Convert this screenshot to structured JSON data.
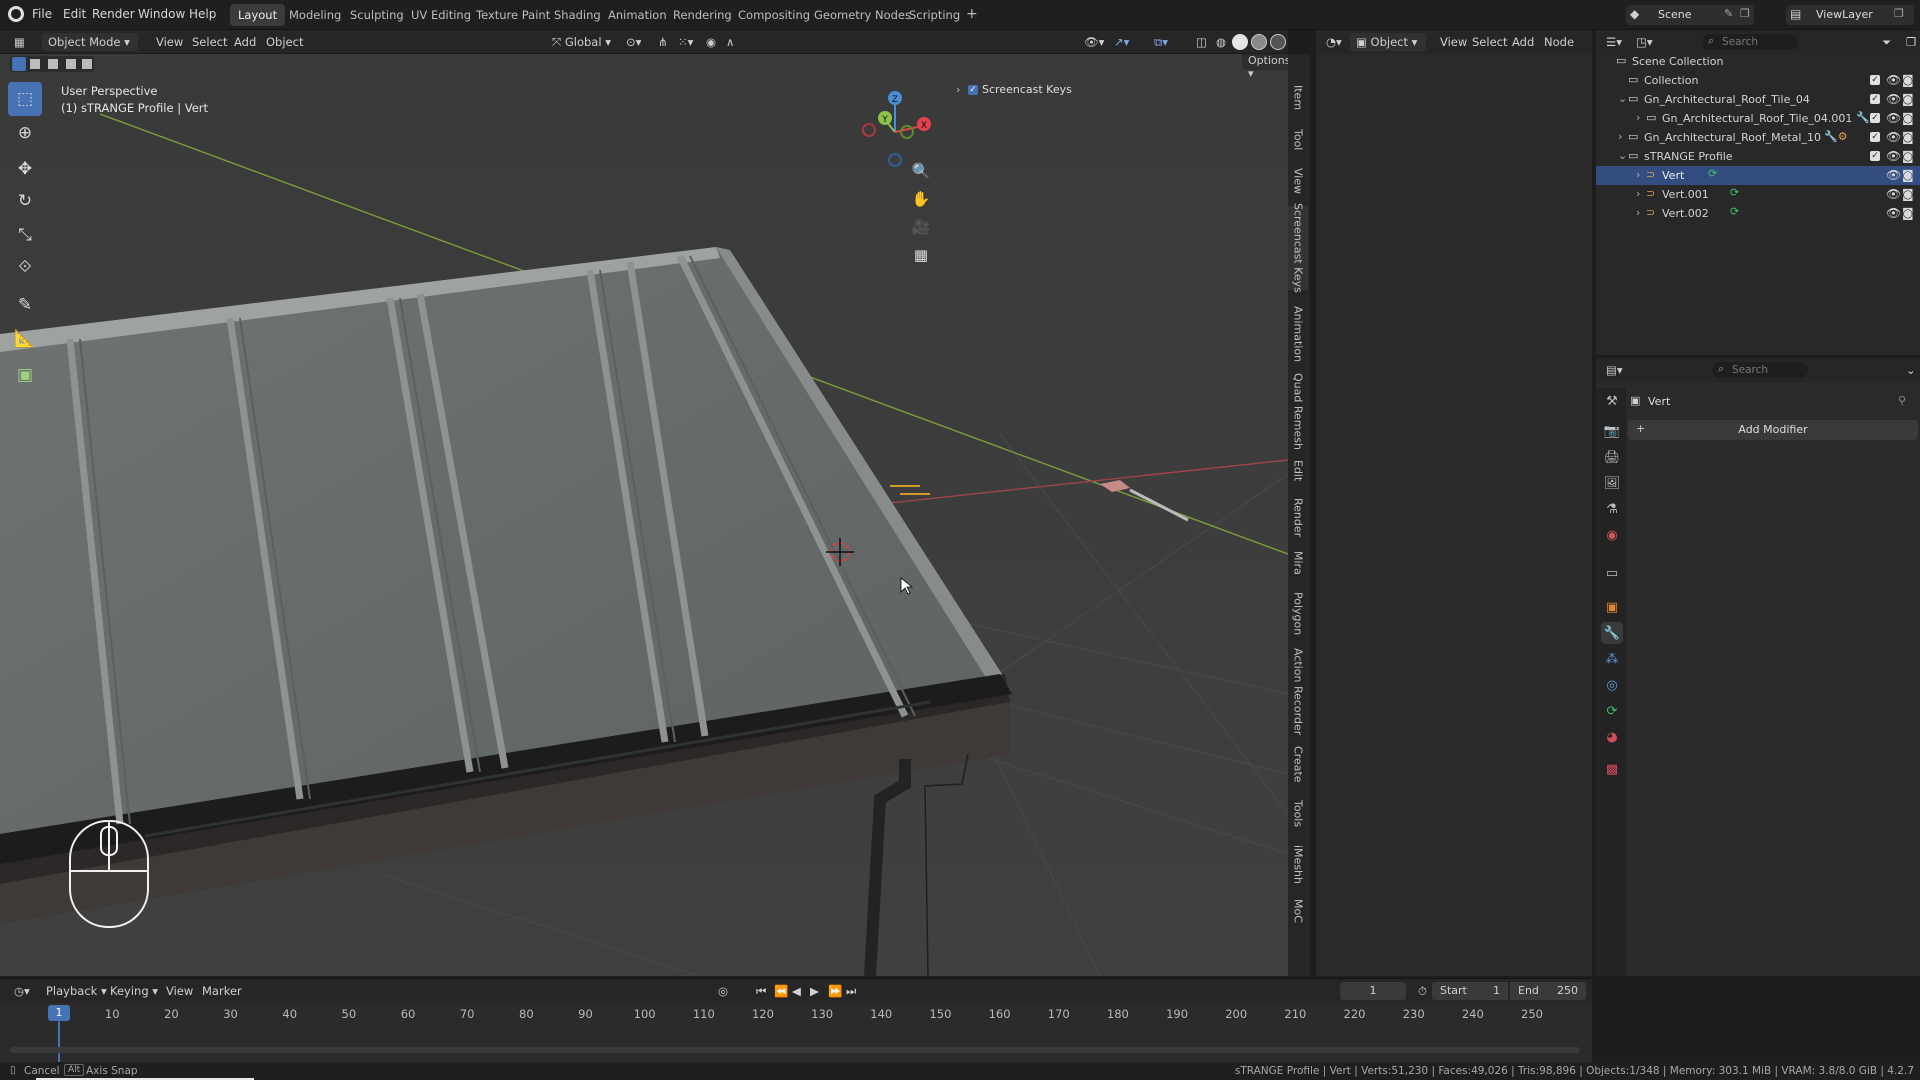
{
  "topbar": {
    "menus": [
      "File",
      "Edit",
      "Render",
      "Window",
      "Help"
    ],
    "workspaces": [
      "Layout",
      "Modeling",
      "Sculpting",
      "UV Editing",
      "Texture Paint",
      "Shading",
      "Animation",
      "Rendering",
      "Compositing",
      "Geometry Nodes",
      "Scripting"
    ],
    "active_workspace": "Layout",
    "add_tab": "+",
    "scene": "Scene",
    "view_layer": "ViewLayer"
  },
  "viewport_header": {
    "mode": "Object Mode",
    "menus": [
      "View",
      "Select",
      "Add",
      "Object"
    ],
    "transform_orientation": "Global",
    "options": "Options"
  },
  "viewport": {
    "perspective": "User Perspective",
    "context": "(1) sTRANGE Profile | Vert",
    "screencast_keys": "Screencast Keys",
    "gizmo_axes": [
      "Z",
      "Y",
      "X"
    ]
  },
  "n_tabs": [
    "Item",
    "Tool",
    "View",
    "Screencast Keys",
    "Animation",
    "Quad Remesh",
    "Edit",
    "Render",
    "Mira",
    "Polygon",
    "Action Recorder",
    "Create",
    "Tools",
    "iMeshh",
    "MoC"
  ],
  "node_header": {
    "object_menu": "Object",
    "menus": [
      "View",
      "Select",
      "Add",
      "Node"
    ]
  },
  "outliner": {
    "search_placeholder": "Search",
    "items": [
      {
        "label": "Scene Collection"
      },
      {
        "label": "Collection"
      },
      {
        "label": "Gn_Architectural_Roof_Tile_04"
      },
      {
        "label": "Gn_Architectural_Roof_Tile_04.001"
      },
      {
        "label": "Gn_Architectural_Roof_Metal_10"
      },
      {
        "label": "sTRANGE Profile"
      },
      {
        "label": "Vert"
      },
      {
        "label": "Vert.001"
      },
      {
        "label": "Vert.002"
      }
    ]
  },
  "properties": {
    "search_placeholder": "Search",
    "object_name": "Vert",
    "add_modifier": "Add Modifier"
  },
  "timeline": {
    "menus": [
      "Playback",
      "Keying",
      "View",
      "Marker"
    ],
    "current_frame": "1",
    "start_label": "Start",
    "start": "1",
    "end_label": "End",
    "end": "250",
    "ruler": [
      "1",
      "10",
      "20",
      "30",
      "40",
      "50",
      "60",
      "70",
      "80",
      "90",
      "100",
      "110",
      "120",
      "130",
      "140",
      "150",
      "160",
      "170",
      "180",
      "190",
      "200",
      "210",
      "220",
      "230",
      "240",
      "250"
    ]
  },
  "statusbar": {
    "cancel": "Cancel",
    "alt_key": "Alt",
    "axis_snap": "Axis Snap",
    "stats": "sTRANGE Profile | Vert | Verts:51,230 | Faces:49,026 | Tris:98,896 | Objects:1/348 | Memory: 303.1 MiB | VRAM: 3.8/8.0 GiB | 4.2.7"
  },
  "colors": {
    "accent": "#4772b3",
    "selected_row": "#334d80",
    "x_axis": "#e0434b",
    "y_axis": "#8bc34a",
    "z_axis": "#4a8fd6"
  }
}
